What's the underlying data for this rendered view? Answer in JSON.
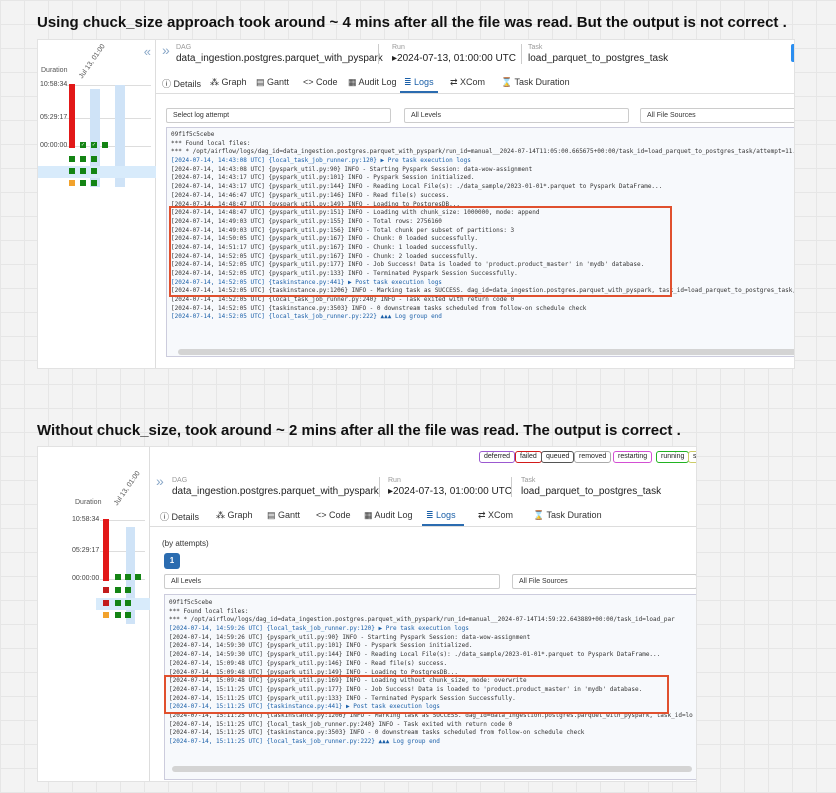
{
  "captions": {
    "top": "Using  chuck_size approach took around ~ 4 mins after all the file was read. But the output is not correct .",
    "bottom": "Without chuck_size, took around ~ 2 mins after all the file was read. The output is correct ."
  },
  "sidebar": {
    "duration_label": "Duration",
    "ticks": [
      "10:58:34",
      "05:29:17",
      "00:00:00"
    ],
    "run_date": "Jul 13, 01:00",
    "colors": {
      "running_bar": "#e21818",
      "success": "#148414",
      "upstream_failed": "#f2a22c",
      "failed": "#c21c1c",
      "highlight": "#d8ebfb"
    }
  },
  "header": {
    "dag_label": "DAG",
    "dag_name": "data_ingestion.postgres.parquet_with_pyspark",
    "run_label": "Run",
    "run_value": "2024-07-13, 01:00:00 UTC",
    "task_label": "Task",
    "task_value": "load_parquet_to_postgres_task"
  },
  "tabs": [
    "Details",
    "Graph",
    "Gantt",
    "Code",
    "Audit Log",
    "Logs",
    "XCom",
    "Task Duration"
  ],
  "tab_icons": [
    "details-icon",
    "graph-icon",
    "gantt-icon",
    "code-icon",
    "audit-log-icon",
    "logs-icon",
    "xcom-icon",
    "hourglass-icon"
  ],
  "active_tab": "Logs",
  "top": {
    "select_attempt": "Select log attempt",
    "select_levels": "All Levels",
    "select_sources": "All File Sources",
    "log_lines": [
      "09f1f5c5cebe",
      "*** Found local files:",
      "***   * /opt/airflow/logs/dag_id=data_ingestion.postgres.parquet_with_pyspark/run_id=manual__2024-07-14T11:05:00.665675+00:00/task_id=load_parquet_to_postgres_task/attempt=11.log",
      "[2024-07-14, 14:43:08 UTC] {local_task_job_runner.py:120} ▶ Pre task execution logs",
      "[2024-07-14, 14:43:08 UTC] {pyspark_util.py:90} INFO - Starting Pyspark Session: data-wow-assignment",
      "[2024-07-14, 14:43:17 UTC] {pyspark_util.py:101} INFO - Pyspark Session initialized.",
      "[2024-07-14, 14:43:17 UTC] {pyspark_util.py:144} INFO - Reading Local File(s): ./data_sample/2023-01-01*.parquet to Pyspark DataFrame...",
      "[2024-07-14, 14:46:47 UTC] {pyspark_util.py:146} INFO - Read file(s) success.",
      "[2024-07-14, 14:48:47 UTC] {pyspark_util.py:149} INFO - Loading to PostgresDB...",
      "[2024-07-14, 14:48:47 UTC] {pyspark_util.py:151} INFO - Loading with chunk_size: 1000000, mode: append",
      "[2024-07-14, 14:49:03 UTC] {pyspark_util.py:155} INFO - Total rows: 2756160",
      "[2024-07-14, 14:49:03 UTC] {pyspark_util.py:156} INFO - Total chunk per subset of partitions: 3",
      "[2024-07-14, 14:50:05 UTC] {pyspark_util.py:167} INFO - Chunk: 0 loaded successfully.",
      "[2024-07-14, 14:51:17 UTC] {pyspark_util.py:167} INFO - Chunk: 1 loaded successfully.",
      "[2024-07-14, 14:52:05 UTC] {pyspark_util.py:167} INFO - Chunk: 2 loaded successfully.",
      "[2024-07-14, 14:52:05 UTC] {pyspark_util.py:177} INFO - Job Success! Data is loaded to 'product.product_master' in 'mydb' database.",
      "[2024-07-14, 14:52:05 UTC] {pyspark_util.py:133} INFO - Terminated Pyspark Session Successfully.",
      "[2024-07-14, 14:52:05 UTC] {taskinstance.py:441} ▶ Post task execution logs",
      "[2024-07-14, 14:52:05 UTC] {taskinstance.py:1206} INFO - Marking task as SUCCESS. dag_id=data_ingestion.postgres.parquet_with_pyspark, task_id=load_parquet_to_postgres_task, run_id=",
      "[2024-07-14, 14:52:05 UTC] {local_task_job_runner.py:240} INFO - Task exited with return code 0",
      "[2024-07-14, 14:52:05 UTC] {taskinstance.py:3503} INFO - 0 downstream tasks scheduled from follow-on schedule check",
      "[2024-07-14, 14:52:05 UTC] {local_task_job_runner.py:222} ▲▲▲ Log group end"
    ]
  },
  "bottom": {
    "legend": [
      "deferred",
      "failed",
      "queued",
      "removed",
      "restarting",
      "running",
      "sch"
    ],
    "legend_colors": [
      "#9b59d0",
      "#d11a1a",
      "#555555",
      "#aaaaaa",
      "#d34fd3",
      "#22b322",
      "#cccc66"
    ],
    "attempts_label": "(by attempts)",
    "attempt_number": "1",
    "select_levels": "All Levels",
    "select_sources": "All File Sources",
    "log_lines": [
      "09f1f5c5cebe",
      "*** Found local files:",
      "***   * /opt/airflow/logs/dag_id=data_ingestion.postgres.parquet_with_pyspark/run_id=manual__2024-07-14T14:59:22.643889+00:00/task_id=load_par",
      "[2024-07-14, 14:59:26 UTC] {local_task_job_runner.py:120} ▶ Pre task execution logs",
      "[2024-07-14, 14:59:26 UTC] {pyspark_util.py:90} INFO - Starting Pyspark Session: data-wow-assignment",
      "[2024-07-14, 14:59:30 UTC] {pyspark_util.py:101} INFO - Pyspark Session initialized.",
      "[2024-07-14, 14:59:30 UTC] {pyspark_util.py:144} INFO - Reading Local File(s): ./data_sample/2023-01-01*.parquet to Pyspark DataFrame...",
      "[2024-07-14, 15:09:48 UTC] {pyspark_util.py:146} INFO - Read file(s) success.",
      "[2024-07-14, 15:09:48 UTC] {pyspark_util.py:149} INFO - Loading to PostgresDB...",
      "[2024-07-14, 15:09:48 UTC] {pyspark_util.py:169} INFO - Loading without chunk_size, mode: overwrite",
      "[2024-07-14, 15:11:25 UTC] {pyspark_util.py:177} INFO - Job Success! Data is loaded to 'product.product_master' in 'mydb' database.",
      "[2024-07-14, 15:11:25 UTC] {pyspark_util.py:133} INFO - Terminated Pyspark Session Successfully.",
      "[2024-07-14, 15:11:25 UTC] {taskinstance.py:441} ▶ Post task execution logs",
      "[2024-07-14, 15:11:25 UTC] {taskinstance.py:1206} INFO - Marking task as SUCCESS. dag_id=data_ingestion.postgres.parquet_with_pyspark, task_id=lo",
      "[2024-07-14, 15:11:25 UTC] {local_task_job_runner.py:240} INFO - Task exited with return code 0",
      "[2024-07-14, 15:11:25 UTC] {taskinstance.py:3503} INFO - 0 downstream tasks scheduled from follow-on schedule check",
      "[2024-07-14, 15:11:25 UTC] {local_task_job_runner.py:222} ▲▲▲ Log group end"
    ]
  }
}
